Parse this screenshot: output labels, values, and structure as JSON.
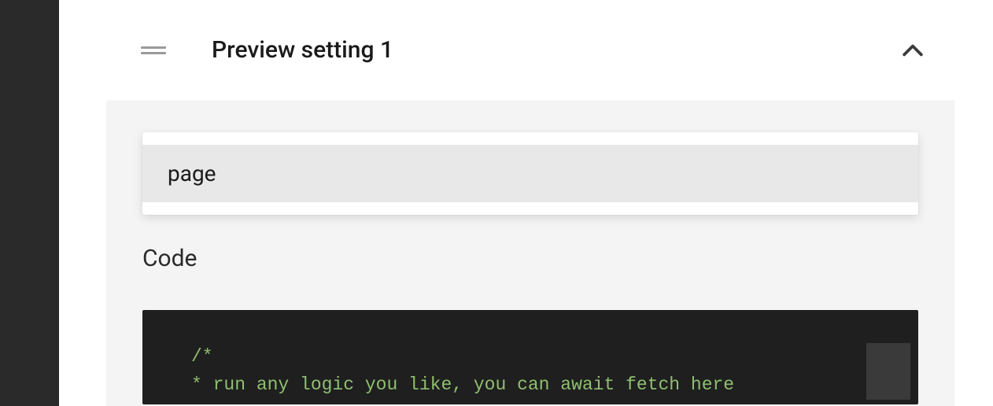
{
  "header": {
    "title": "Preview setting 1"
  },
  "tabs": {
    "active": "page"
  },
  "section": {
    "code_label": "Code"
  },
  "code": {
    "lines": [
      "/*",
      "* run any logic you like, you can await fetch here"
    ],
    "color": "#8fbf6f"
  }
}
